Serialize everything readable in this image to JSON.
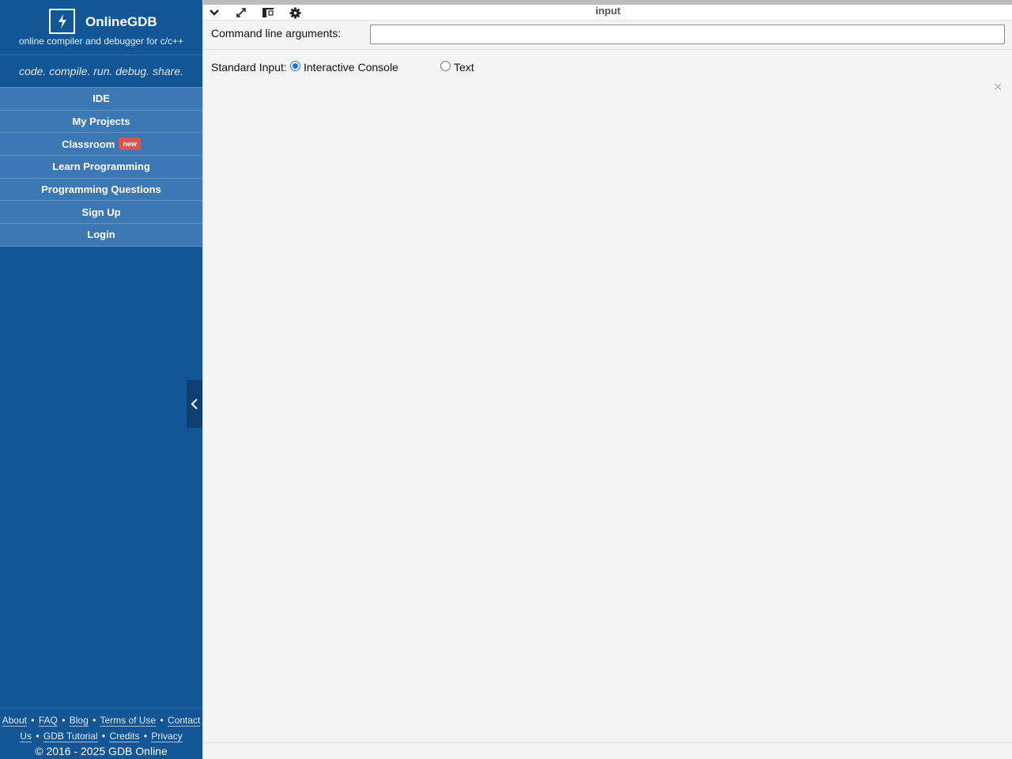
{
  "brand": {
    "name": "OnlineGDB",
    "subtitle": "online compiler and debugger for c/c++",
    "tagline": "code. compile. run. debug. share."
  },
  "nav": {
    "items": [
      {
        "label": "IDE"
      },
      {
        "label": "My Projects"
      },
      {
        "label": "Classroom",
        "badge": "new"
      },
      {
        "label": "Learn Programming"
      },
      {
        "label": "Programming Questions"
      },
      {
        "label": "Sign Up"
      },
      {
        "label": "Login"
      }
    ]
  },
  "footer": {
    "links": [
      "About",
      "FAQ",
      "Blog",
      "Terms of Use",
      "Contact Us",
      "GDB Tutorial",
      "Credits",
      "Privacy"
    ],
    "separator": "•",
    "copyright": "© 2016 - 2025 GDB Online"
  },
  "panel": {
    "title": "input",
    "icons": [
      "chevron-down-icon",
      "expand-icon",
      "layout-icon",
      "gear-icon"
    ],
    "args_label": "Command line arguments:",
    "args_value": "",
    "stdin_label": "Standard Input:",
    "stdin_options": [
      {
        "label": "Interactive Console",
        "selected": true
      },
      {
        "label": "Text",
        "selected": false
      }
    ],
    "close_symbol": "×"
  },
  "colors": {
    "sidebar": "#125696",
    "nav_item": "#3c79b4",
    "badge": "#d9534f",
    "main_bg": "#f4f4f4"
  }
}
